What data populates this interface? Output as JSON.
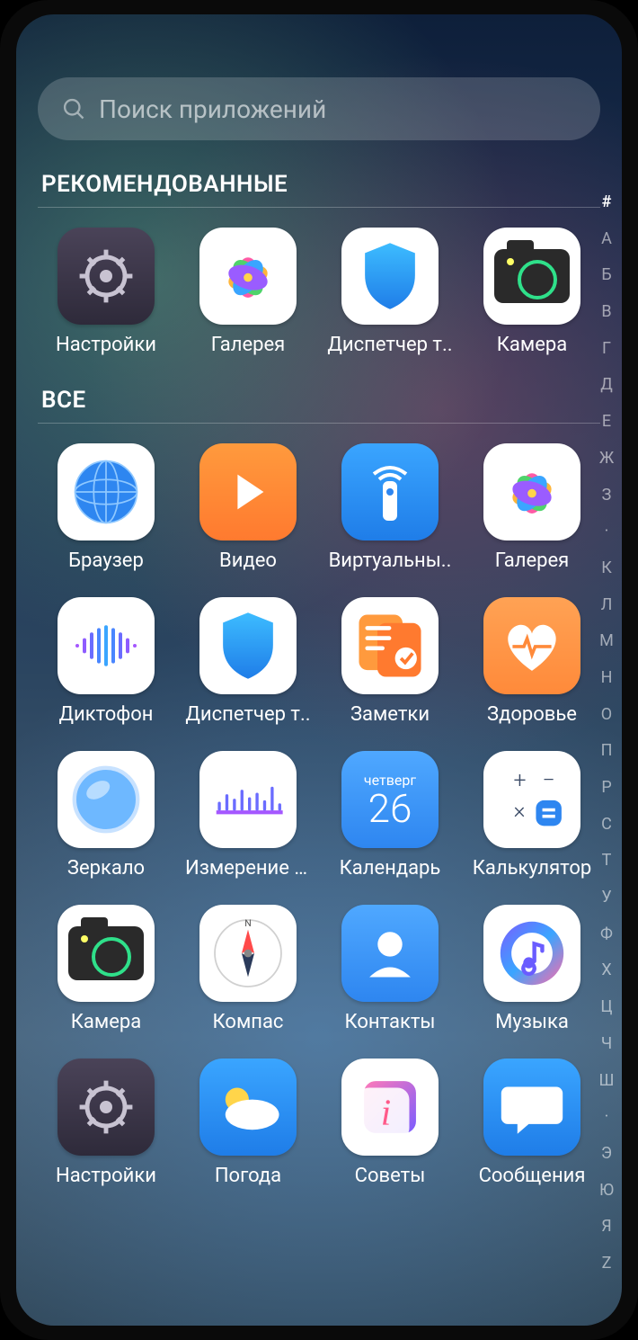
{
  "search": {
    "placeholder": "Поиск приложений"
  },
  "sections": {
    "recommended": {
      "title": "РЕКОМЕНДОВАННЫЕ"
    },
    "all": {
      "title": "ВСЕ"
    }
  },
  "calendar": {
    "dow": "четверг",
    "day": "26"
  },
  "recommended_apps": [
    {
      "id": "settings",
      "label": "Настройки"
    },
    {
      "id": "gallery",
      "label": "Галерея"
    },
    {
      "id": "phonemgr",
      "label": "Диспетчер т.."
    },
    {
      "id": "camera",
      "label": "Камера"
    }
  ],
  "all_apps": [
    {
      "id": "browser",
      "label": "Браузер"
    },
    {
      "id": "video",
      "label": "Видео"
    },
    {
      "id": "remote",
      "label": "Виртуальны.."
    },
    {
      "id": "gallery",
      "label": "Галерея"
    },
    {
      "id": "recorder",
      "label": "Диктофон"
    },
    {
      "id": "phonemgr",
      "label": "Диспетчер т.."
    },
    {
      "id": "notes",
      "label": "Заметки"
    },
    {
      "id": "health",
      "label": "Здоровье"
    },
    {
      "id": "mirror",
      "label": "Зеркало"
    },
    {
      "id": "soundmeter",
      "label": "Измерение с.."
    },
    {
      "id": "calendar",
      "label": "Календарь"
    },
    {
      "id": "calculator",
      "label": "Калькулятор"
    },
    {
      "id": "camera",
      "label": "Камера"
    },
    {
      "id": "compass",
      "label": "Компас"
    },
    {
      "id": "contacts",
      "label": "Контакты"
    },
    {
      "id": "music",
      "label": "Музыка"
    },
    {
      "id": "settings",
      "label": "Настройки"
    },
    {
      "id": "weather",
      "label": "Погода"
    },
    {
      "id": "tips",
      "label": "Советы"
    },
    {
      "id": "messages",
      "label": "Сообщения"
    }
  ],
  "index_letters": [
    "#",
    "А",
    "Б",
    "В",
    "Г",
    "Д",
    "Е",
    "Ж",
    "З",
    "·",
    "К",
    "Л",
    "М",
    "Н",
    "О",
    "П",
    "Р",
    "С",
    "Т",
    "У",
    "Ф",
    "Х",
    "Ц",
    "Ч",
    "Ш",
    "·",
    "Э",
    "Ю",
    "Я",
    "Z"
  ],
  "index_active": "#"
}
